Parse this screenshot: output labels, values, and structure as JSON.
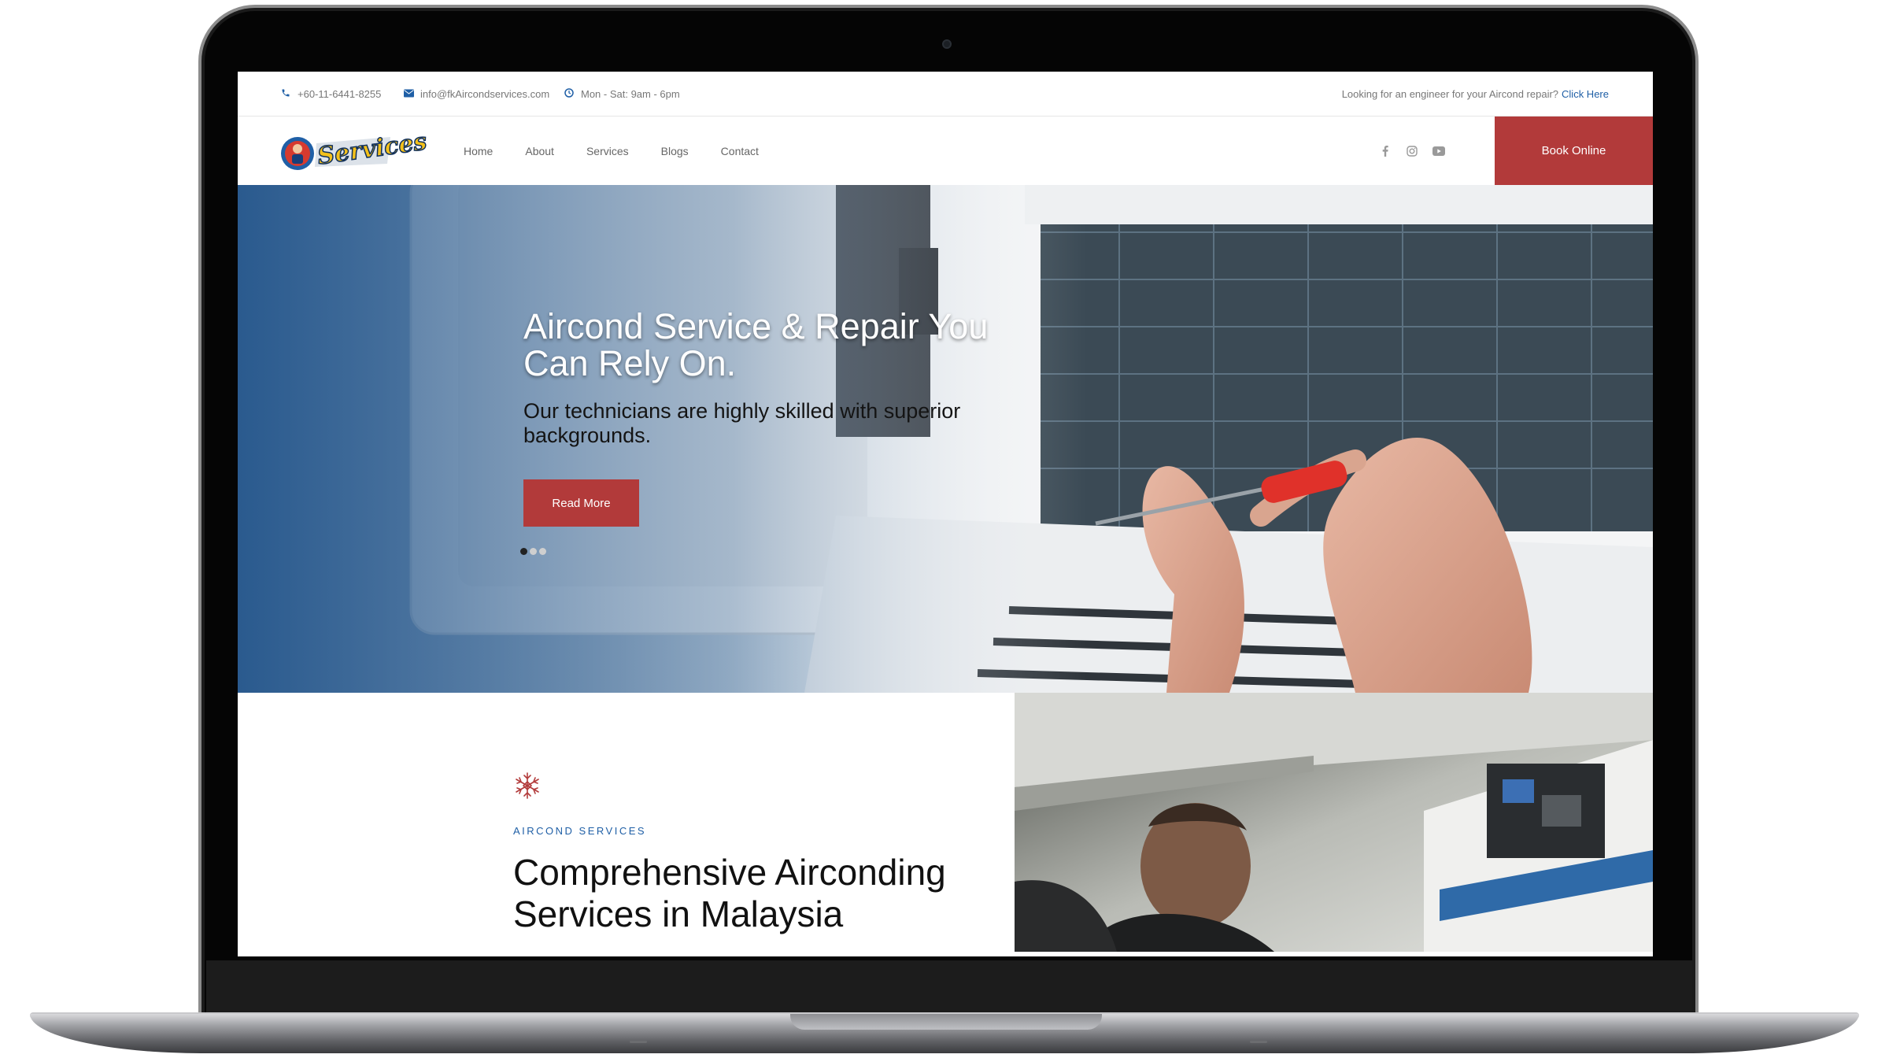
{
  "topbar": {
    "phone": "+60-11-6441-8255",
    "email": "info@fkAircondservices.com",
    "hours": "Mon - Sat: 9am - 6pm",
    "promo_text": "Looking for an engineer for your Aircond repair?",
    "promo_link": "Click Here"
  },
  "header": {
    "logo_text": "Services",
    "nav": [
      "Home",
      "About",
      "Services",
      "Blogs",
      "Contact"
    ],
    "social": [
      "facebook-icon",
      "instagram-icon",
      "youtube-icon"
    ],
    "book_label": "Book Online"
  },
  "hero": {
    "title": "Aircond Service & Repair You Can Rely On.",
    "subtitle": "Our technicians are highly skilled with superior backgrounds.",
    "button_label": "Read More",
    "slides_total": 3,
    "active_slide": 1
  },
  "services": {
    "icon": "snowflake-icon",
    "eyebrow": "AIRCOND SERVICES",
    "title": "Comprehensive Airconding Services in Malaysia"
  },
  "colors": {
    "accent_red": "#b23a3a",
    "link_blue": "#1f5fa6"
  }
}
